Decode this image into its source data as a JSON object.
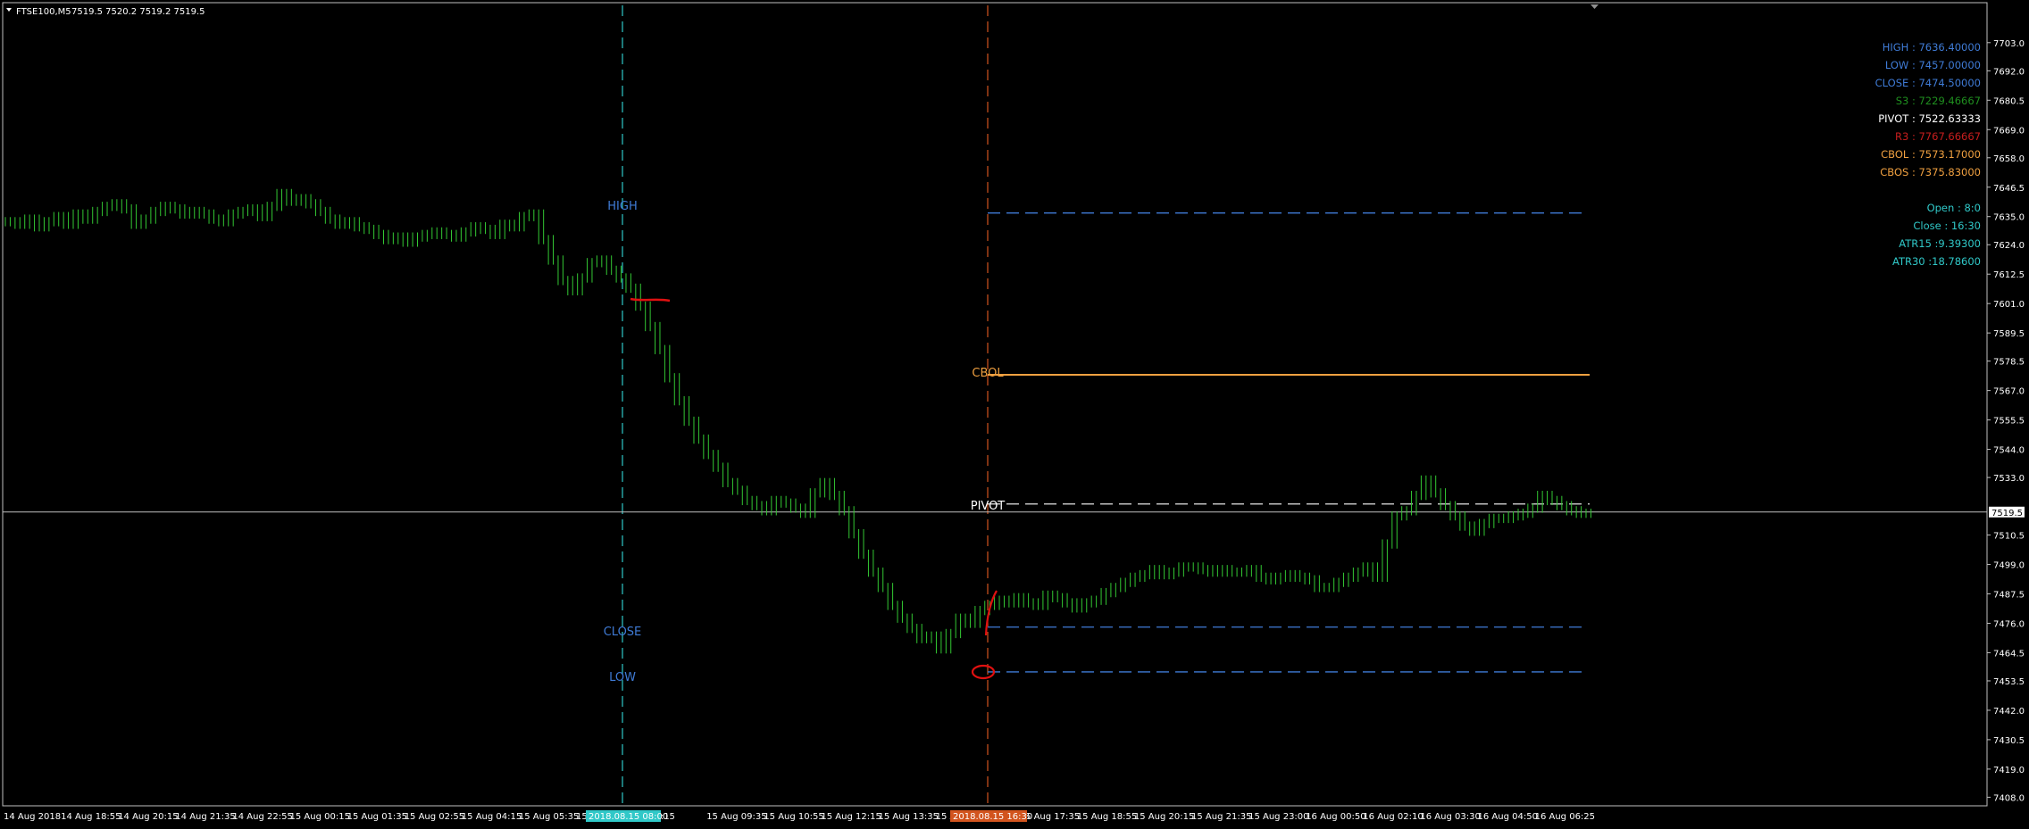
{
  "header": {
    "title": "FTSE100,M5",
    "quote": "7519.5 7520.2 7519.2 7519.5"
  },
  "colors": {
    "background": "#000000",
    "frame": "#c0c0c0",
    "bars": "#33c833",
    "high": "#3f7bd6",
    "low": "#3f7bd6",
    "close": "#3f7bd6",
    "pivot": "#ffffff",
    "s3": "#1f8f1f",
    "r3": "#c81e1e",
    "cbol": "#f0a040",
    "cbos": "#f0a040",
    "session": "#30c8c8",
    "period_start": "#30c8c8",
    "period_end": "#d2541e",
    "annotation": "#e01010",
    "current_price_line": "#c0c0c0"
  },
  "price_axis": {
    "ticks": [
      "7703.0",
      "7692.0",
      "7680.5",
      "7669.0",
      "7658.0",
      "7646.5",
      "7635.0",
      "7624.0",
      "7612.5",
      "7601.0",
      "7589.5",
      "7578.5",
      "7567.0",
      "7555.5",
      "7544.0",
      "7533.0",
      "7510.5",
      "7499.0",
      "7487.5",
      "7476.0",
      "7464.5",
      "7453.5",
      "7442.0",
      "7430.5",
      "7419.0",
      "7408.0"
    ],
    "current_price": "7519.5"
  },
  "time_axis": {
    "labels": [
      "14 Aug 2018",
      "14 Aug 18:55",
      "14 Aug 20:15",
      "14 Aug 21:35",
      "14 Aug 22:55",
      "15 Aug 00:15",
      "15 Aug 01:35",
      "15 Aug 02:55",
      "15 Aug 04:15",
      "15 Aug 05:35",
      "15",
      "08:15",
      "15 Aug 09:35",
      "15 Aug 10:55",
      "15 Aug 12:15",
      "15 Aug 13:35",
      "15 Aug",
      "15 Aug 17:35",
      "15 Aug 18:55",
      "15 Aug 20:15",
      "15 Aug 21:35",
      "15 Aug 23:00",
      "16 Aug 00:50",
      "16 Aug 02:10",
      "16 Aug 03:30",
      "16 Aug 04:50",
      "16 Aug 06:25"
    ],
    "highlight_start": "2018.08.15 08:00",
    "highlight_end": "2018.08.15 16:30"
  },
  "levels": {
    "high": "HIGH",
    "low": "LOW",
    "close": "CLOSE",
    "pivot": "PIVOT",
    "cbol": "CBOL"
  },
  "info_panel": {
    "high": "HIGH : 7636.40000",
    "low": "LOW : 7457.00000",
    "close": "CLOSE : 7474.50000",
    "s3": "S3 : 7229.46667",
    "pivot": "PIVOT : 7522.63333",
    "r3": "R3 : 7767.66667",
    "cbol": "CBOL : 7573.17000",
    "cbos": "CBOS : 7375.83000",
    "open_time": "Open : 8:0",
    "close_time": "Close : 16:30",
    "atr15": "ATR15 :9.39300",
    "atr30": "ATR30 :18.78600"
  },
  "chart_data": {
    "type": "line",
    "symbol": "FTSE100,M5",
    "ylim": [
      7405,
      7712
    ],
    "series": [
      {
        "values": [
          7633,
          7632,
          7634,
          7631,
          7633,
          7635,
          7632,
          7636,
          7634,
          7637,
          7639,
          7640,
          7638,
          7632,
          7634,
          7637,
          7639,
          7638,
          7636,
          7637,
          7636,
          7634,
          7633,
          7636,
          7637,
          7638,
          7635,
          7639,
          7644,
          7641,
          7642,
          7640,
          7637,
          7634,
          7632,
          7633,
          7631,
          7630,
          7628,
          7626,
          7627,
          7625,
          7627,
          7628,
          7629,
          7628,
          7627,
          7629,
          7631,
          7630,
          7628,
          7632,
          7631,
          7635,
          7636,
          7626,
          7618,
          7610,
          7606,
          7611,
          7617,
          7618,
          7614,
          7611,
          7607,
          7600,
          7592,
          7583,
          7572,
          7563,
          7555,
          7548,
          7542,
          7537,
          7531,
          7528,
          7524,
          7522,
          7520,
          7524,
          7523,
          7521,
          7519,
          7527,
          7531,
          7526,
          7520,
          7511,
          7503,
          7496,
          7490,
          7483,
          7478,
          7474,
          7470,
          7471,
          7466,
          7472,
          7478,
          7476,
          7481,
          7483,
          7485,
          7484,
          7486,
          7484,
          7483,
          7487,
          7486,
          7484,
          7482,
          7484,
          7485,
          7488,
          7490,
          7492,
          7494,
          7495,
          7497,
          7495,
          7496,
          7498,
          7498,
          7497,
          7496,
          7497,
          7496,
          7496,
          7497,
          7494,
          7493,
          7494,
          7495,
          7494,
          7493,
          7490,
          7490,
          7492,
          7494,
          7496,
          7498,
          7494,
          7507,
          7518,
          7520,
          7526,
          7532,
          7527,
          7522,
          7518,
          7514,
          7512,
          7515,
          7517,
          7517,
          7518,
          7519,
          7521,
          7526,
          7524,
          7522,
          7520,
          7519,
          7519
        ]
      }
    ],
    "levels": [
      {
        "name": "HIGH",
        "value": 7636.4
      },
      {
        "name": "LOW",
        "value": 7457.0
      },
      {
        "name": "CLOSE",
        "value": 7474.5
      },
      {
        "name": "PIVOT",
        "value": 7522.63333
      },
      {
        "name": "CBOL",
        "value": 7573.17
      },
      {
        "name": "CBOS",
        "value": 7375.83
      },
      {
        "name": "S3",
        "value": 7229.46667
      },
      {
        "name": "R3",
        "value": 7767.66667
      }
    ],
    "current_price": 7519.5,
    "grid": false
  }
}
